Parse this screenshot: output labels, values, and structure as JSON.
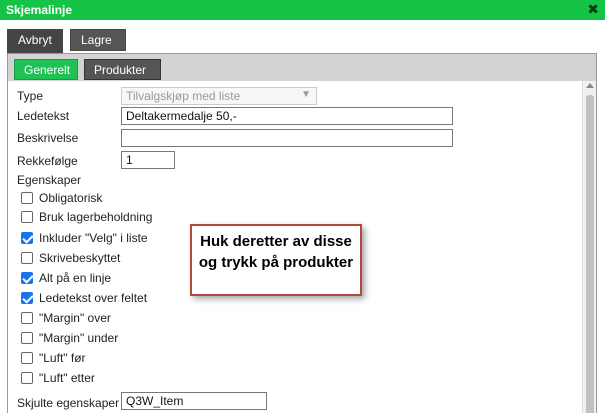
{
  "window": {
    "title": "Skjemalinje",
    "close_icon": "close-icon"
  },
  "toolbar": {
    "cancel_label": "Avbryt",
    "save_label": "Lagre"
  },
  "tabs": [
    {
      "label": "Generelt",
      "active": true
    },
    {
      "label": "Produkter",
      "active": false
    }
  ],
  "form": {
    "type_label": "Type",
    "type_value": "Tilvalgskjøp med liste",
    "ledetekst_label": "Ledetekst",
    "ledetekst_value": "Deltakermedalje 50,-",
    "beskrivelse_label": "Beskrivelse",
    "beskrivelse_value": "",
    "rekkefolge_label": "Rekkefølge",
    "rekkefolge_value": "1",
    "egenskaper_label": "Egenskaper",
    "checkboxes": [
      {
        "label": "Obligatorisk",
        "checked": false
      },
      {
        "label": "Bruk lagerbeholdning",
        "checked": false
      },
      {
        "label": "Inkluder \"Velg\" i liste",
        "checked": true
      },
      {
        "label": "Skrivebeskyttet",
        "checked": false
      },
      {
        "label": "Alt på en linje",
        "checked": true
      },
      {
        "label": "Ledetekst over feltet",
        "checked": true
      },
      {
        "label": "\"Margin\" over",
        "checked": false
      },
      {
        "label": "\"Margin\" under",
        "checked": false
      },
      {
        "label": "\"Luft\" før",
        "checked": false
      },
      {
        "label": "\"Luft\" etter",
        "checked": false
      }
    ],
    "skjulte_label": "Skjulte egenskaper",
    "skjulte_value": "Q3W_Item"
  },
  "callout": {
    "text": "Huk deretter av disse og trykk på produkter"
  },
  "colors": {
    "titlebar": "#15c447",
    "active_tab": "#1ec255",
    "callout_border": "#b24a3a",
    "checkbox_checked": "#1a73e8"
  }
}
